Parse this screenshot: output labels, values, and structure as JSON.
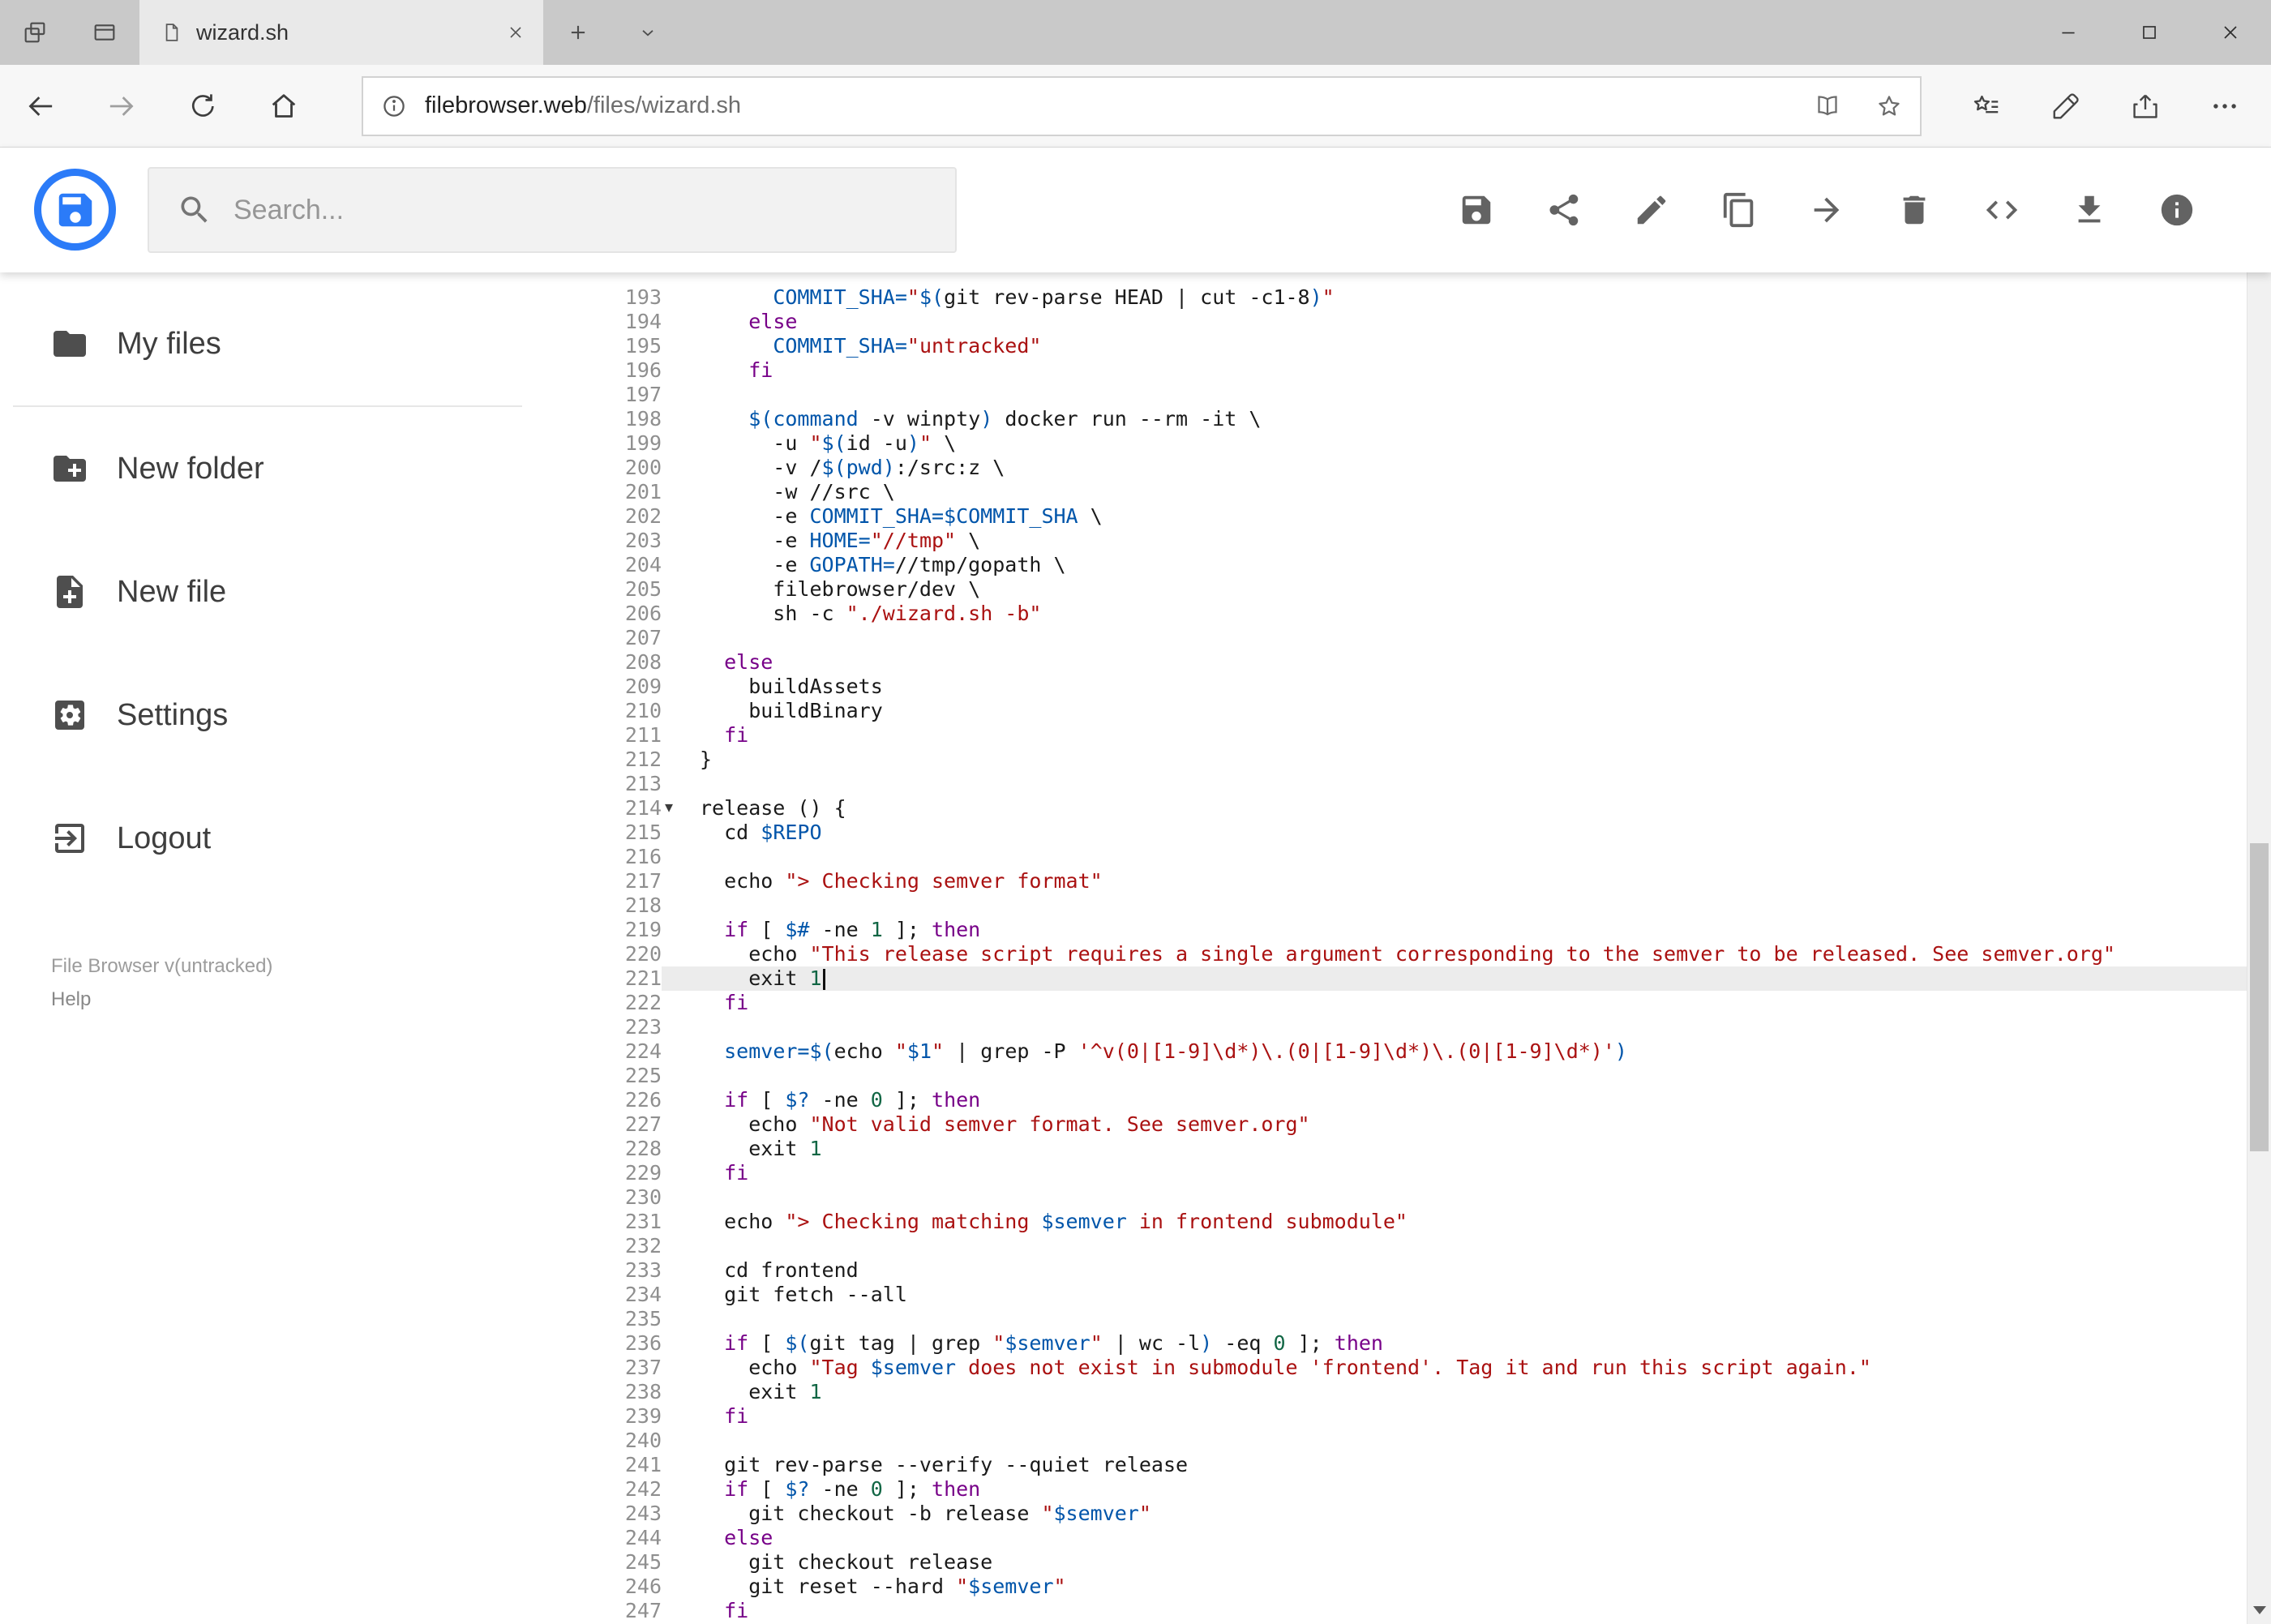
{
  "browser": {
    "tab_title": "wizard.sh",
    "url_domain": "filebrowser.web",
    "url_path": "/files/wizard.sh",
    "chrome_icons": [
      "set-tabs-aside-icon",
      "tab-preview-icon",
      "page-icon",
      "close-icon",
      "new-tab-icon",
      "chevron-down-icon",
      "minimize-icon",
      "maximize-icon",
      "window-close-icon",
      "back-icon",
      "forward-icon",
      "refresh-icon",
      "home-icon",
      "info-icon",
      "reading-view-icon",
      "favorite-star-icon",
      "hub-icon",
      "ink-pen-icon",
      "share-icon",
      "more-icon"
    ]
  },
  "header": {
    "search_placeholder": "Search...",
    "toolbar_icons": [
      "save-icon",
      "share-icon",
      "edit-icon",
      "copy-icon",
      "move-icon",
      "delete-icon",
      "code-icon",
      "download-icon",
      "info-icon"
    ]
  },
  "sidebar": {
    "items": [
      {
        "label": "My files",
        "icon": "folder-icon"
      },
      {
        "label": "New folder",
        "icon": "new-folder-icon"
      },
      {
        "label": "New file",
        "icon": "new-file-icon"
      },
      {
        "label": "Settings",
        "icon": "settings-icon"
      },
      {
        "label": "Logout",
        "icon": "logout-icon"
      }
    ],
    "footer_version": "File Browser v(untracked)",
    "footer_help": "Help"
  },
  "colors": {
    "accent_blue": "#2b7bf8",
    "active_line_bg": "#ececec",
    "syntax": {
      "keyword": "#770088",
      "string": "#aa1111",
      "variable": "#0055aa",
      "number": "#116644",
      "plain": "#1a1a1a"
    }
  },
  "editor": {
    "first_line": 193,
    "active_line": 221,
    "fold_marker_line": 214,
    "lines": [
      {
        "n": 193,
        "t": [
          [
            "p",
            "      "
          ],
          [
            "v",
            "COMMIT_SHA="
          ],
          [
            "s",
            "\""
          ],
          [
            "v",
            "$("
          ],
          [
            "p",
            "git rev-parse HEAD | cut -c1-8"
          ],
          [
            "v",
            ")"
          ],
          [
            "s",
            "\""
          ]
        ]
      },
      {
        "n": 194,
        "t": [
          [
            "p",
            "    "
          ],
          [
            "k",
            "else"
          ]
        ]
      },
      {
        "n": 195,
        "t": [
          [
            "p",
            "      "
          ],
          [
            "v",
            "COMMIT_SHA="
          ],
          [
            "s",
            "\"untracked\""
          ]
        ]
      },
      {
        "n": 196,
        "t": [
          [
            "p",
            "    "
          ],
          [
            "k",
            "fi"
          ]
        ]
      },
      {
        "n": 197,
        "t": []
      },
      {
        "n": 198,
        "t": [
          [
            "p",
            "    "
          ],
          [
            "v",
            "$(command"
          ],
          [
            "p",
            " -v winpty"
          ],
          [
            "v",
            ")"
          ],
          [
            "p",
            " docker run --rm -it \\"
          ]
        ]
      },
      {
        "n": 199,
        "t": [
          [
            "p",
            "      -u "
          ],
          [
            "s",
            "\""
          ],
          [
            "v",
            "$("
          ],
          [
            "p",
            "id -u"
          ],
          [
            "v",
            ")"
          ],
          [
            "s",
            "\""
          ],
          [
            "p",
            " \\"
          ]
        ]
      },
      {
        "n": 200,
        "t": [
          [
            "p",
            "      -v /"
          ],
          [
            "v",
            "$(pwd)"
          ],
          [
            "p",
            ":/src:z \\"
          ]
        ]
      },
      {
        "n": 201,
        "t": [
          [
            "p",
            "      -w //src \\"
          ]
        ]
      },
      {
        "n": 202,
        "t": [
          [
            "p",
            "      -e "
          ],
          [
            "v",
            "COMMIT_SHA=$COMMIT_SHA"
          ],
          [
            "p",
            " \\"
          ]
        ]
      },
      {
        "n": 203,
        "t": [
          [
            "p",
            "      -e "
          ],
          [
            "v",
            "HOME="
          ],
          [
            "s",
            "\"//tmp\""
          ],
          [
            "p",
            " \\"
          ]
        ]
      },
      {
        "n": 204,
        "t": [
          [
            "p",
            "      -e "
          ],
          [
            "v",
            "GOPATH="
          ],
          [
            "p",
            "//tmp/gopath \\"
          ]
        ]
      },
      {
        "n": 205,
        "t": [
          [
            "p",
            "      filebrowser/dev \\"
          ]
        ]
      },
      {
        "n": 206,
        "t": [
          [
            "p",
            "      sh -c "
          ],
          [
            "s",
            "\"./wizard.sh -b\""
          ]
        ]
      },
      {
        "n": 207,
        "t": []
      },
      {
        "n": 208,
        "t": [
          [
            "p",
            "  "
          ],
          [
            "k",
            "else"
          ]
        ]
      },
      {
        "n": 209,
        "t": [
          [
            "p",
            "    buildAssets"
          ]
        ]
      },
      {
        "n": 210,
        "t": [
          [
            "p",
            "    buildBinary"
          ]
        ]
      },
      {
        "n": 211,
        "t": [
          [
            "p",
            "  "
          ],
          [
            "k",
            "fi"
          ]
        ]
      },
      {
        "n": 212,
        "t": [
          [
            "p",
            "}"
          ]
        ]
      },
      {
        "n": 213,
        "t": []
      },
      {
        "n": 214,
        "t": [
          [
            "p",
            "release () {"
          ]
        ]
      },
      {
        "n": 215,
        "t": [
          [
            "p",
            "  cd "
          ],
          [
            "v",
            "$REPO"
          ]
        ]
      },
      {
        "n": 216,
        "t": []
      },
      {
        "n": 217,
        "t": [
          [
            "p",
            "  echo "
          ],
          [
            "s",
            "\"> Checking semver format\""
          ]
        ]
      },
      {
        "n": 218,
        "t": []
      },
      {
        "n": 219,
        "t": [
          [
            "p",
            "  "
          ],
          [
            "k",
            "if"
          ],
          [
            "p",
            " [ "
          ],
          [
            "v",
            "$#"
          ],
          [
            "p",
            " -ne "
          ],
          [
            "n2",
            "1"
          ],
          [
            "p",
            " ]; "
          ],
          [
            "k",
            "then"
          ]
        ]
      },
      {
        "n": 220,
        "t": [
          [
            "p",
            "    echo "
          ],
          [
            "s",
            "\"This release script requires a single argument corresponding to the semver to be released. See semver.org\""
          ]
        ]
      },
      {
        "n": 221,
        "t": [
          [
            "p",
            "    exit "
          ],
          [
            "n2",
            "1"
          ]
        ]
      },
      {
        "n": 222,
        "t": [
          [
            "p",
            "  "
          ],
          [
            "k",
            "fi"
          ]
        ]
      },
      {
        "n": 223,
        "t": []
      },
      {
        "n": 224,
        "t": [
          [
            "p",
            "  "
          ],
          [
            "v",
            "semver=$("
          ],
          [
            "p",
            "echo "
          ],
          [
            "s",
            "\""
          ],
          [
            "v",
            "$1"
          ],
          [
            "s",
            "\""
          ],
          [
            "p",
            " | grep -P "
          ],
          [
            "s",
            "'^v(0|[1-9]\\d*)\\.(0|[1-9]\\d*)\\.(0|[1-9]\\d*)'"
          ],
          [
            "v",
            ")"
          ]
        ]
      },
      {
        "n": 225,
        "t": []
      },
      {
        "n": 226,
        "t": [
          [
            "p",
            "  "
          ],
          [
            "k",
            "if"
          ],
          [
            "p",
            " [ "
          ],
          [
            "v",
            "$?"
          ],
          [
            "p",
            " -ne "
          ],
          [
            "n2",
            "0"
          ],
          [
            "p",
            " ]; "
          ],
          [
            "k",
            "then"
          ]
        ]
      },
      {
        "n": 227,
        "t": [
          [
            "p",
            "    echo "
          ],
          [
            "s",
            "\"Not valid semver format. See semver.org\""
          ]
        ]
      },
      {
        "n": 228,
        "t": [
          [
            "p",
            "    exit "
          ],
          [
            "n2",
            "1"
          ]
        ]
      },
      {
        "n": 229,
        "t": [
          [
            "p",
            "  "
          ],
          [
            "k",
            "fi"
          ]
        ]
      },
      {
        "n": 230,
        "t": []
      },
      {
        "n": 231,
        "t": [
          [
            "p",
            "  echo "
          ],
          [
            "s",
            "\"> Checking matching "
          ],
          [
            "v",
            "$semver"
          ],
          [
            "s",
            " in frontend submodule\""
          ]
        ]
      },
      {
        "n": 232,
        "t": []
      },
      {
        "n": 233,
        "t": [
          [
            "p",
            "  cd frontend"
          ]
        ]
      },
      {
        "n": 234,
        "t": [
          [
            "p",
            "  git fetch --all"
          ]
        ]
      },
      {
        "n": 235,
        "t": []
      },
      {
        "n": 236,
        "t": [
          [
            "p",
            "  "
          ],
          [
            "k",
            "if"
          ],
          [
            "p",
            " [ "
          ],
          [
            "v",
            "$("
          ],
          [
            "p",
            "git tag | grep "
          ],
          [
            "s",
            "\""
          ],
          [
            "v",
            "$semver"
          ],
          [
            "s",
            "\""
          ],
          [
            "p",
            " | wc -l"
          ],
          [
            "v",
            ")"
          ],
          [
            "p",
            " -eq "
          ],
          [
            "n2",
            "0"
          ],
          [
            "p",
            " ]; "
          ],
          [
            "k",
            "then"
          ]
        ]
      },
      {
        "n": 237,
        "t": [
          [
            "p",
            "    echo "
          ],
          [
            "s",
            "\"Tag "
          ],
          [
            "v",
            "$semver"
          ],
          [
            "s",
            " does not exist in submodule 'frontend'. Tag it and run this script again.\""
          ]
        ]
      },
      {
        "n": 238,
        "t": [
          [
            "p",
            "    exit "
          ],
          [
            "n2",
            "1"
          ]
        ]
      },
      {
        "n": 239,
        "t": [
          [
            "p",
            "  "
          ],
          [
            "k",
            "fi"
          ]
        ]
      },
      {
        "n": 240,
        "t": []
      },
      {
        "n": 241,
        "t": [
          [
            "p",
            "  git rev-parse --verify --quiet release"
          ]
        ]
      },
      {
        "n": 242,
        "t": [
          [
            "p",
            "  "
          ],
          [
            "k",
            "if"
          ],
          [
            "p",
            " [ "
          ],
          [
            "v",
            "$?"
          ],
          [
            "p",
            " -ne "
          ],
          [
            "n2",
            "0"
          ],
          [
            "p",
            " ]; "
          ],
          [
            "k",
            "then"
          ]
        ]
      },
      {
        "n": 243,
        "t": [
          [
            "p",
            "    git checkout -b release "
          ],
          [
            "s",
            "\""
          ],
          [
            "v",
            "$semver"
          ],
          [
            "s",
            "\""
          ]
        ]
      },
      {
        "n": 244,
        "t": [
          [
            "p",
            "  "
          ],
          [
            "k",
            "else"
          ]
        ]
      },
      {
        "n": 245,
        "t": [
          [
            "p",
            "    git checkout release"
          ]
        ]
      },
      {
        "n": 246,
        "t": [
          [
            "p",
            "    git reset --hard "
          ],
          [
            "s",
            "\""
          ],
          [
            "v",
            "$semver"
          ],
          [
            "s",
            "\""
          ]
        ]
      },
      {
        "n": 247,
        "t": [
          [
            "p",
            "  "
          ],
          [
            "k",
            "fi"
          ]
        ]
      }
    ]
  }
}
